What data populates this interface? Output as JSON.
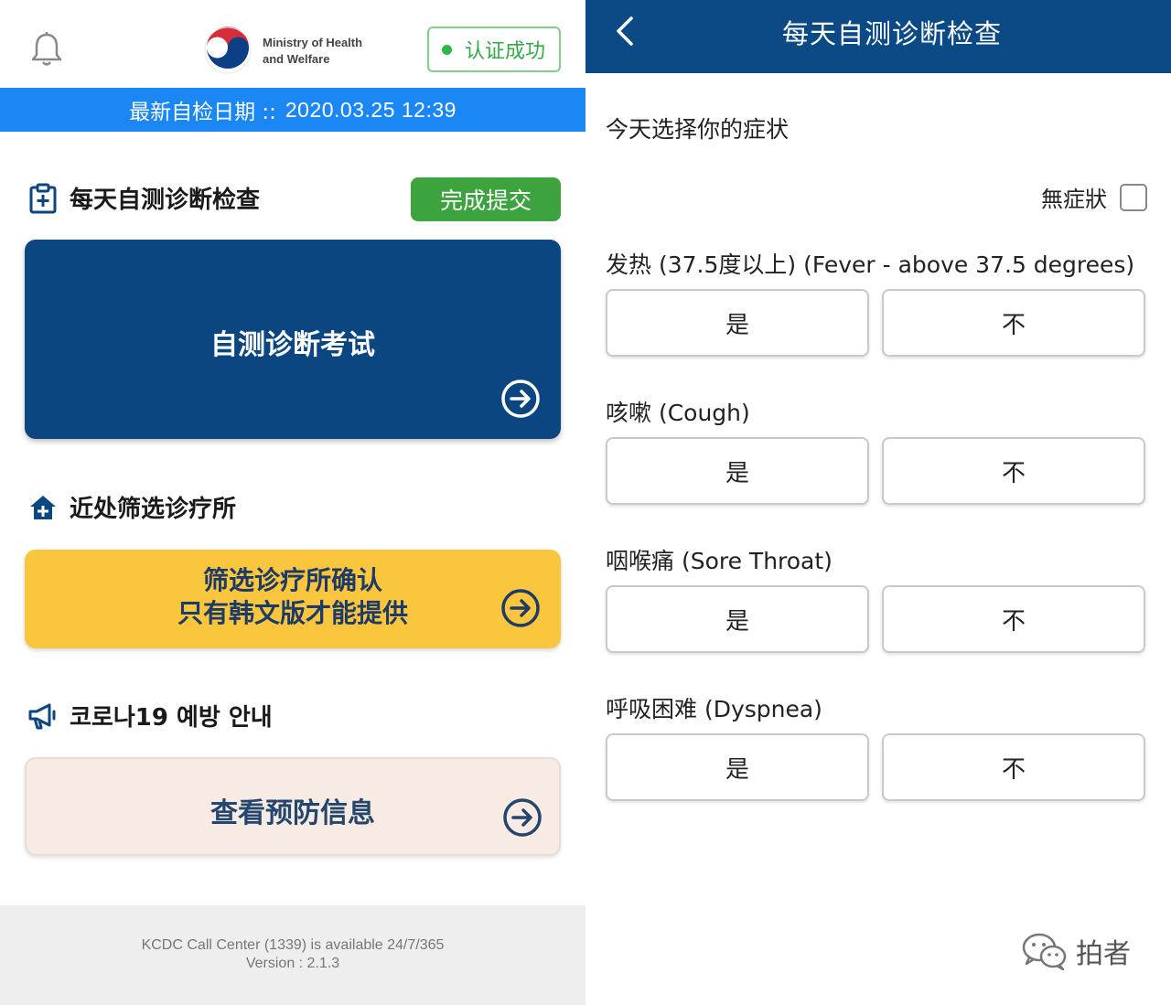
{
  "left": {
    "ministry_line1": "Ministry of Health",
    "ministry_line2": "and Welfare",
    "verified_label": "认证成功",
    "latest_check_label": "最新自检日期 ::",
    "latest_check_value": "2020.03.25 12:39",
    "daily_check": {
      "title": "每天自测诊断检查",
      "submit_label": "完成提交",
      "card_label": "自测诊断考试"
    },
    "clinics": {
      "title": "近处筛选诊疗所",
      "card_line1": "筛选诊疗所确认",
      "card_line2": "只有韩文版才能提供"
    },
    "prevention": {
      "title": "코로나19 예방 안내",
      "card_label": "查看预防信息"
    },
    "footer_line1": "KCDC Call Center (1339) is available 24/7/365",
    "footer_line2": "Version : 2.1.3"
  },
  "right": {
    "nav_title": "每天自测诊断检查",
    "prompt": "今天选择你的症状",
    "no_symptoms_label": "無症狀",
    "questions": [
      {
        "label": "发热 (37.5度以上) (Fever - above 37.5 degrees)",
        "yes": "是",
        "no": "不"
      },
      {
        "label": "咳嗽 (Cough)",
        "yes": "是",
        "no": "不"
      },
      {
        "label": "咽喉痛 (Sore Throat)",
        "yes": "是",
        "no": "不"
      },
      {
        "label": "呼吸困难 (Dyspnea)",
        "yes": "是",
        "no": "不"
      }
    ],
    "watermark": "拍者"
  },
  "colors": {
    "date_bar": "#1a87f5",
    "primary_navy": "#0c4680",
    "nav_bar": "#0b4a85",
    "submit_green": "#3ca33e",
    "verified_green": "#2fb54a",
    "clinic_yellow": "#f9c63e",
    "prevention_pink": "#f8ebe4"
  },
  "icons": [
    "bell-icon",
    "mohw-logo",
    "clipboard-plus-icon",
    "home-plus-icon",
    "megaphone-icon",
    "arrow-circle-right-icon",
    "back-chevron-icon",
    "wechat-icon"
  ]
}
